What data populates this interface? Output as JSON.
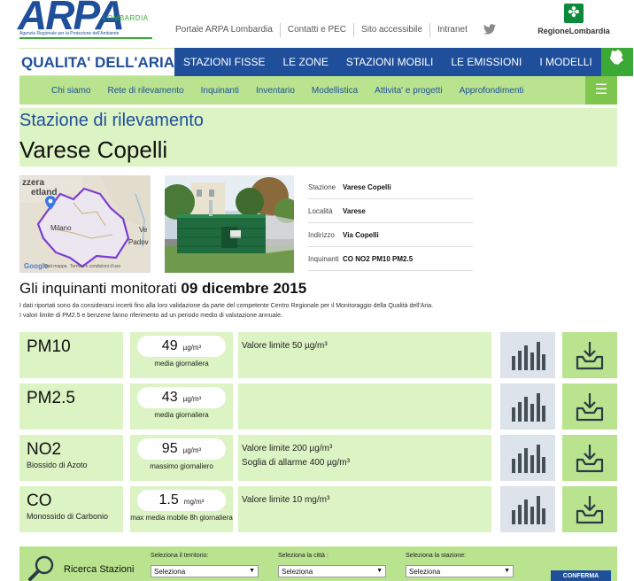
{
  "header": {
    "logo_main": "ARPA",
    "logo_region": "LOMBARDIA",
    "logo_sub": "Agenzia Regionale per la Protezione dell'Ambiente",
    "links": [
      "Portale ARPA Lombardia",
      "Contatti e PEC",
      "Sito accessibile",
      "Intranet"
    ],
    "region_logo": "RegioneLombardia"
  },
  "nav": {
    "brand": "QUALITA' DELL'ARIA",
    "items": [
      "STAZIONI FISSE",
      "LE ZONE",
      "STAZIONI MOBILI",
      "LE EMISSIONI",
      "I MODELLI"
    ]
  },
  "subnav": {
    "items": [
      "Chi siamo",
      "Rete di rilevamento",
      "Inquinanti",
      "Inventario",
      "Modellistica",
      "Attivita' e progetti",
      "Approfondimenti"
    ]
  },
  "station": {
    "kicker": "Stazione di rilevamento",
    "name": "Varese Copelli"
  },
  "map": {
    "labels": [
      "zzera",
      "etland",
      "Milano",
      "Ve",
      "Padov"
    ],
    "footer": "Google",
    "footer_data": "Dati mappa",
    "footer_terms": "Termini e condizioni d'uso"
  },
  "details": [
    {
      "label": "Stazione",
      "value": "Varese Copelli"
    },
    {
      "label": "Località",
      "value": "Varese"
    },
    {
      "label": "Indirizzo",
      "value": "Via Copelli"
    },
    {
      "label": "Inquinanti",
      "value": "CO NO2 PM10 PM2.5"
    }
  ],
  "pollutants_heading": {
    "text": "Gli inquinanti monitorati",
    "date": "09 dicembre 2015"
  },
  "note": {
    "line1": "I dati riportati sono da considerarsi incerti fino alla loro validazione da parte del competente Centro Regionale per il Monitoraggio della Qualità dell'Aria.",
    "line2": "I valori limite di PM2.5 e benzene fanno riferimento ad un periodo medio di valutazione annuale."
  },
  "pollutants": [
    {
      "name": "PM10",
      "full": "",
      "value": "49",
      "unit": "µg/m³",
      "kind": "media giornaliera",
      "limit1": "Valore limite 50 µg/m³",
      "limit2": ""
    },
    {
      "name": "PM2.5",
      "full": "",
      "value": "43",
      "unit": "µg/m³",
      "kind": "media giornaliera",
      "limit1": "",
      "limit2": ""
    },
    {
      "name": "NO2",
      "full": "Biossido di Azoto",
      "value": "95",
      "unit": "µg/m³",
      "kind": "massimo giornaliero",
      "limit1": "Valore limite 200 µg/m³",
      "limit2": "Soglia di allarme 400 µg/m³"
    },
    {
      "name": "CO",
      "full": "Monossido di Carbonio",
      "value": "1.5",
      "unit": "mg/m³",
      "kind": "max media mobile 8h giornaliera",
      "limit1": "Valore limite 10 mg/m³",
      "limit2": ""
    }
  ],
  "search": {
    "title": "Ricerca Stazioni",
    "selects": [
      {
        "label": "Seleziona il territorio:",
        "value": "Seleziona"
      },
      {
        "label": "Seleziona la città :",
        "value": "Seleziona"
      },
      {
        "label": "Seleziona la stazione:",
        "value": "Seleziona"
      }
    ],
    "button": "CONFERMA"
  },
  "colors": {
    "brand_blue": "#1f4f9b",
    "brand_green": "#3aa935",
    "light_green": "#dcf3c4",
    "mid_green": "#b9e38e"
  }
}
